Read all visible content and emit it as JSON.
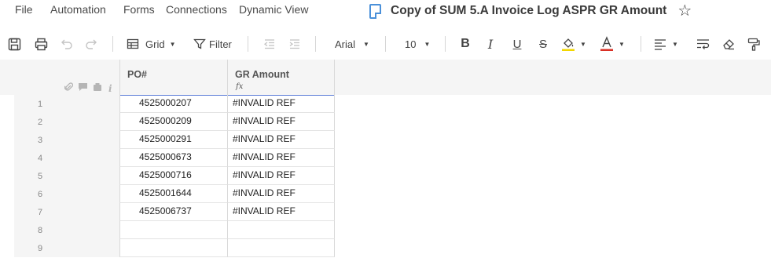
{
  "menu": {
    "file": "File",
    "automation": "Automation",
    "forms": "Forms",
    "connections": "Connections",
    "dynamic_view": "Dynamic View"
  },
  "document": {
    "title": "Copy of SUM 5.A Invoice Log ASPR GR Amount",
    "icon": "sheet-icon"
  },
  "toolbar": {
    "view_label": "Grid",
    "filter_label": "Filter",
    "font_family": "Arial",
    "font_size": "10",
    "icons": [
      "save-icon",
      "print-icon",
      "undo-icon",
      "redo-icon",
      "grid-icon",
      "filter-icon",
      "outdent-icon",
      "indent-icon",
      "bold-icon",
      "italic-icon",
      "underline-icon",
      "strikethrough-icon",
      "fill-color-icon",
      "text-color-icon",
      "align-icon",
      "wrap-icon",
      "clear-format-icon",
      "format-painter-icon"
    ],
    "fill_color": "#f2d600",
    "text_color": "#d93025"
  },
  "grid": {
    "header_icons": [
      "attachment-icon",
      "comment-icon",
      "proofing-icon",
      "info-icon"
    ],
    "columns": [
      {
        "name": "PO#",
        "formula": ""
      },
      {
        "name": "GR Amount",
        "formula": "fx"
      }
    ],
    "rows": [
      {
        "num": "1",
        "po": "4525000207",
        "gr": "#INVALID REF"
      },
      {
        "num": "2",
        "po": "4525000209",
        "gr": "#INVALID REF"
      },
      {
        "num": "3",
        "po": "4525000291",
        "gr": "#INVALID REF"
      },
      {
        "num": "4",
        "po": "4525000673",
        "gr": "#INVALID REF"
      },
      {
        "num": "5",
        "po": "4525000716",
        "gr": "#INVALID REF"
      },
      {
        "num": "6",
        "po": "4525001644",
        "gr": "#INVALID REF"
      },
      {
        "num": "7",
        "po": "4525006737",
        "gr": "#INVALID REF"
      },
      {
        "num": "8",
        "po": "",
        "gr": ""
      },
      {
        "num": "9",
        "po": "",
        "gr": ""
      }
    ]
  }
}
